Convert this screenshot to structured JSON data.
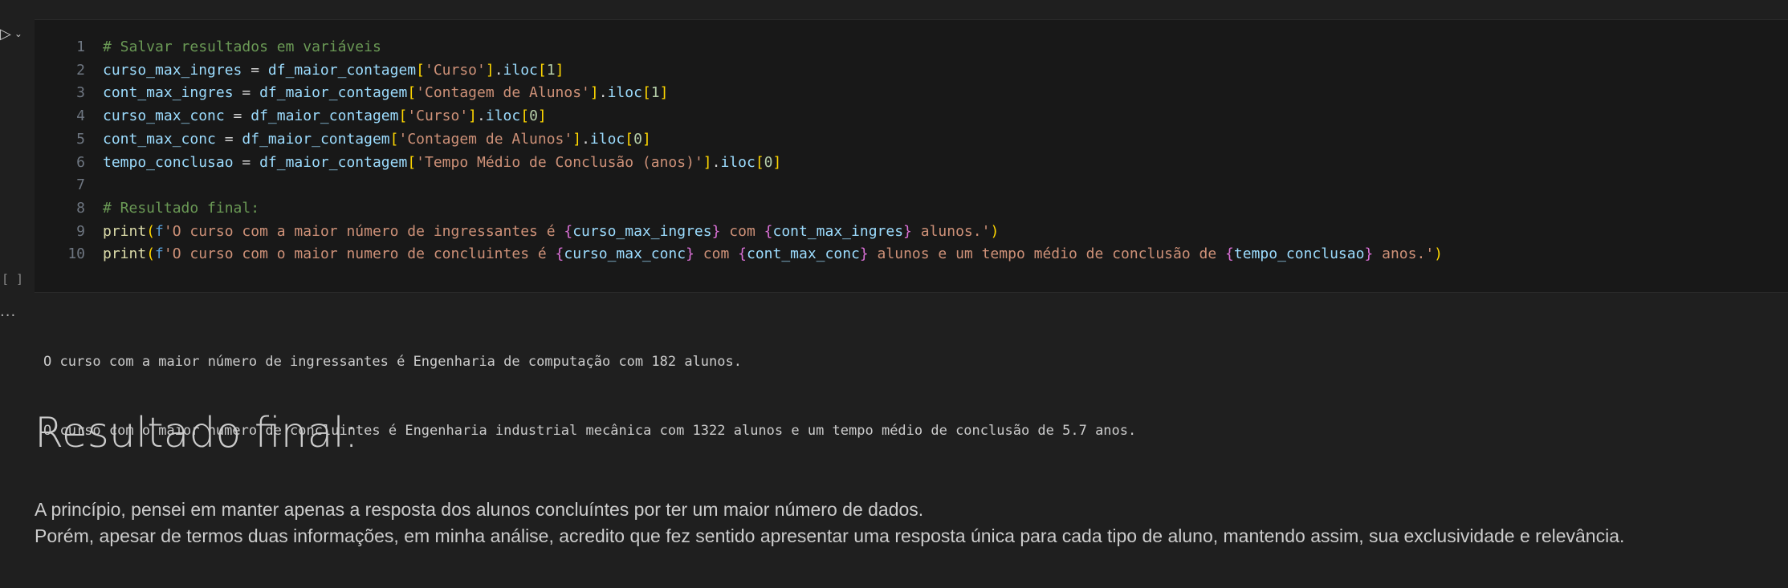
{
  "cell_gutter": {
    "run_icon": "run-chevron-icon",
    "collapse_icon": "chevron-down-icon",
    "exec_count": "[ ]",
    "output_menu": "..."
  },
  "code": {
    "lines": [
      {
        "n": "1",
        "tokens": [
          {
            "t": "# Salvar resultados em variáveis",
            "c": "comment"
          }
        ]
      },
      {
        "n": "2",
        "tokens": [
          {
            "t": "curso_max_ingres",
            "c": "var"
          },
          {
            "t": " = ",
            "c": "op"
          },
          {
            "t": "df_maior_contagem",
            "c": "var"
          },
          {
            "t": "[",
            "c": "b1"
          },
          {
            "t": "'Curso'",
            "c": "str"
          },
          {
            "t": "]",
            "c": "b1"
          },
          {
            "t": ".",
            "c": "op"
          },
          {
            "t": "iloc",
            "c": "var"
          },
          {
            "t": "[",
            "c": "b1"
          },
          {
            "t": "1",
            "c": "num"
          },
          {
            "t": "]",
            "c": "b1"
          }
        ]
      },
      {
        "n": "3",
        "tokens": [
          {
            "t": "cont_max_ingres",
            "c": "var"
          },
          {
            "t": " = ",
            "c": "op"
          },
          {
            "t": "df_maior_contagem",
            "c": "var"
          },
          {
            "t": "[",
            "c": "b1"
          },
          {
            "t": "'Contagem de Alunos'",
            "c": "str"
          },
          {
            "t": "]",
            "c": "b1"
          },
          {
            "t": ".",
            "c": "op"
          },
          {
            "t": "iloc",
            "c": "var"
          },
          {
            "t": "[",
            "c": "b1"
          },
          {
            "t": "1",
            "c": "num"
          },
          {
            "t": "]",
            "c": "b1"
          }
        ]
      },
      {
        "n": "4",
        "tokens": [
          {
            "t": "curso_max_conc",
            "c": "var"
          },
          {
            "t": " = ",
            "c": "op"
          },
          {
            "t": "df_maior_contagem",
            "c": "var"
          },
          {
            "t": "[",
            "c": "b1"
          },
          {
            "t": "'Curso'",
            "c": "str"
          },
          {
            "t": "]",
            "c": "b1"
          },
          {
            "t": ".",
            "c": "op"
          },
          {
            "t": "iloc",
            "c": "var"
          },
          {
            "t": "[",
            "c": "b1"
          },
          {
            "t": "0",
            "c": "num"
          },
          {
            "t": "]",
            "c": "b1"
          }
        ]
      },
      {
        "n": "5",
        "tokens": [
          {
            "t": "cont_max_conc",
            "c": "var"
          },
          {
            "t": " = ",
            "c": "op"
          },
          {
            "t": "df_maior_contagem",
            "c": "var"
          },
          {
            "t": "[",
            "c": "b1"
          },
          {
            "t": "'Contagem de Alunos'",
            "c": "str"
          },
          {
            "t": "]",
            "c": "b1"
          },
          {
            "t": ".",
            "c": "op"
          },
          {
            "t": "iloc",
            "c": "var"
          },
          {
            "t": "[",
            "c": "b1"
          },
          {
            "t": "0",
            "c": "num"
          },
          {
            "t": "]",
            "c": "b1"
          }
        ]
      },
      {
        "n": "6",
        "tokens": [
          {
            "t": "tempo_conclusao",
            "c": "var"
          },
          {
            "t": " = ",
            "c": "op"
          },
          {
            "t": "df_maior_contagem",
            "c": "var"
          },
          {
            "t": "[",
            "c": "b1"
          },
          {
            "t": "'Tempo Médio de Conclusão (anos)'",
            "c": "str"
          },
          {
            "t": "]",
            "c": "b1"
          },
          {
            "t": ".",
            "c": "op"
          },
          {
            "t": "iloc",
            "c": "var"
          },
          {
            "t": "[",
            "c": "b1"
          },
          {
            "t": "0",
            "c": "num"
          },
          {
            "t": "]",
            "c": "b1"
          }
        ]
      },
      {
        "n": "7",
        "tokens": []
      },
      {
        "n": "8",
        "tokens": [
          {
            "t": "# Resultado final:",
            "c": "comment"
          }
        ]
      },
      {
        "n": "9",
        "tokens": [
          {
            "t": "print",
            "c": "fn"
          },
          {
            "t": "(",
            "c": "b1"
          },
          {
            "t": "f",
            "c": "kw"
          },
          {
            "t": "'O curso com a maior número de ingressantes é ",
            "c": "str"
          },
          {
            "t": "{",
            "c": "b2"
          },
          {
            "t": "curso_max_ingres",
            "c": "var"
          },
          {
            "t": "}",
            "c": "b2"
          },
          {
            "t": " com ",
            "c": "str"
          },
          {
            "t": "{",
            "c": "b2"
          },
          {
            "t": "cont_max_ingres",
            "c": "var"
          },
          {
            "t": "}",
            "c": "b2"
          },
          {
            "t": " alunos.'",
            "c": "str"
          },
          {
            "t": ")",
            "c": "b1"
          }
        ]
      },
      {
        "n": "10",
        "tokens": [
          {
            "t": "print",
            "c": "fn"
          },
          {
            "t": "(",
            "c": "b1"
          },
          {
            "t": "f",
            "c": "kw"
          },
          {
            "t": "'O curso com o maior numero de concluintes é ",
            "c": "str"
          },
          {
            "t": "{",
            "c": "b2"
          },
          {
            "t": "curso_max_conc",
            "c": "var"
          },
          {
            "t": "}",
            "c": "b2"
          },
          {
            "t": " com ",
            "c": "str"
          },
          {
            "t": "{",
            "c": "b2"
          },
          {
            "t": "cont_max_conc",
            "c": "var"
          },
          {
            "t": "}",
            "c": "b2"
          },
          {
            "t": " alunos e um tempo médio de conclusão de ",
            "c": "str"
          },
          {
            "t": "{",
            "c": "b2"
          },
          {
            "t": "tempo_conclusao",
            "c": "var"
          },
          {
            "t": "}",
            "c": "b2"
          },
          {
            "t": " anos.'",
            "c": "str"
          },
          {
            "t": ")",
            "c": "b1"
          }
        ]
      }
    ]
  },
  "output": {
    "lines": [
      "O curso com a maior número de ingressantes é Engenharia de computação com 182 alunos.",
      "O curso com o maior numero de concluintes é Engenharia industrial mecânica com 1322 alunos e um tempo médio de conclusão de 5.7 anos."
    ]
  },
  "markdown": {
    "heading": "Resultado final:",
    "paragraph_lines": [
      "A princípio, pensei em manter apenas a resposta dos alunos concluíntes por ter um maior número de dados.",
      "Porém, apesar de termos duas informações, em minha análise, acredito que fez sentido apresentar uma resposta única para cada tipo de aluno, mantendo assim, sua exclusividade e relevância."
    ]
  }
}
